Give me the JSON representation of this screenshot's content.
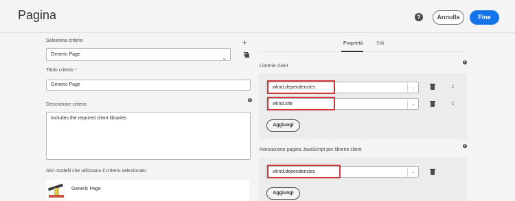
{
  "header": {
    "title": "Pagina",
    "cancel_label": "Annulla",
    "done_label": "Fine"
  },
  "left": {
    "policy_select_label": "Seleziona criterio",
    "policy_select_value": "Generic Page",
    "policy_title_label": "Titolo criterio *",
    "policy_title_value": "Generic Page",
    "policy_description_label": "Descrizione criterio",
    "policy_description_value": "Includes the required client libraries",
    "other_templates_label": "Altri modelli che utilizzano il criterio selezionato",
    "templates": [
      {
        "name": "Generic Page"
      }
    ]
  },
  "tabs": [
    {
      "label": "Proprietà",
      "active": true
    },
    {
      "label": "Stili",
      "active": false
    }
  ],
  "right": {
    "client_libraries_label": "Librerie client",
    "client_libraries": [
      {
        "value": "wknd.dependencies"
      },
      {
        "value": "wknd.site"
      }
    ],
    "add_label": "Aggiungi",
    "js_head_label": "Intestazione pagina JavaScript per librerie client",
    "js_head_libraries": [
      {
        "value": "wknd.dependencies"
      }
    ],
    "add_label_2": "Aggiungi"
  },
  "colors": {
    "primary": "#1473e6",
    "highlight": "#d0383a"
  }
}
